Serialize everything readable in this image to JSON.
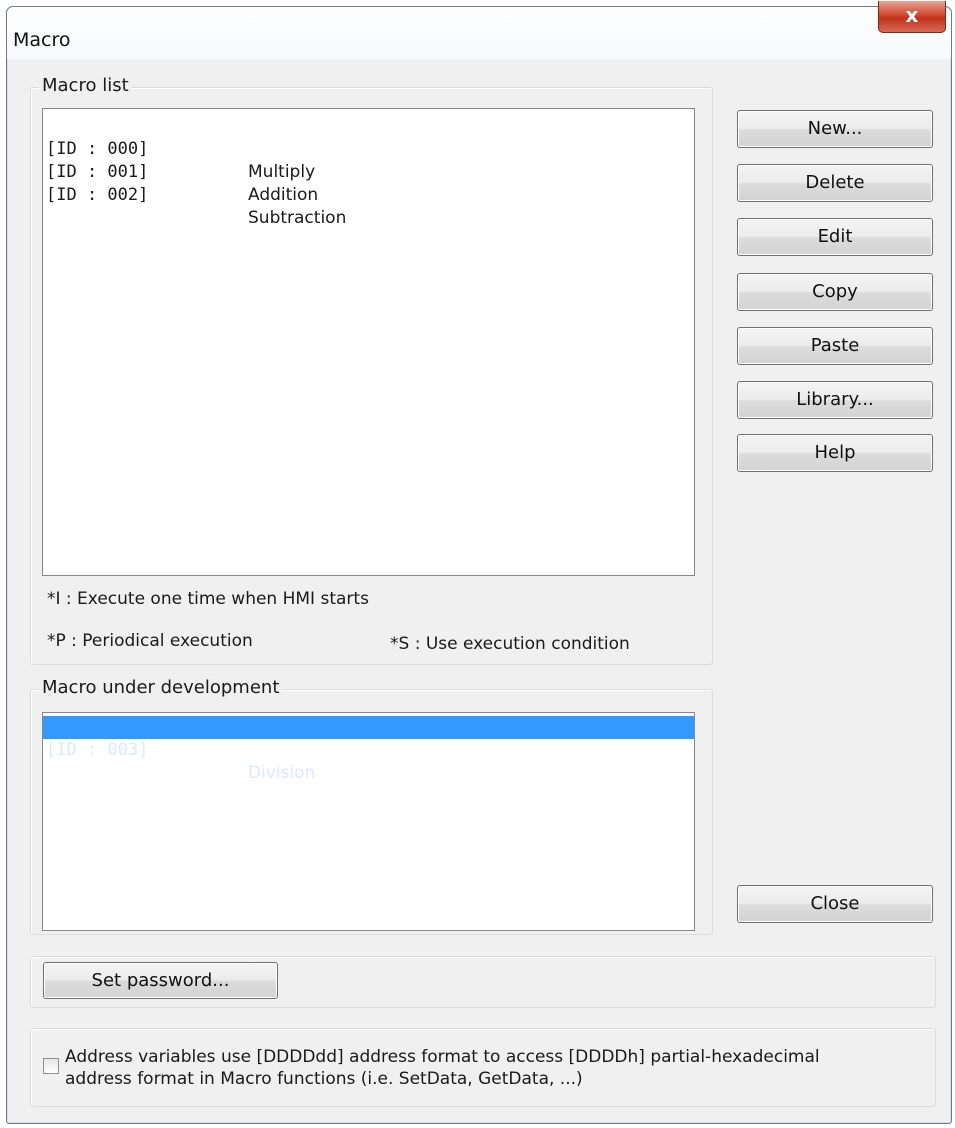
{
  "window": {
    "title": "Macro",
    "close_glyph": "x"
  },
  "macro_list": {
    "label": "Macro list",
    "items": [
      {
        "id": "[ID : 000]",
        "name": "Multiply"
      },
      {
        "id": "[ID : 001]",
        "name": "Addition"
      },
      {
        "id": "[ID : 002]",
        "name": "Subtraction"
      }
    ],
    "notes": {
      "i": "*I : Execute one time when HMI starts",
      "p": "*P : Periodical execution",
      "s": "*S : Use execution condition"
    }
  },
  "macro_dev": {
    "label": "Macro under development",
    "items": [
      {
        "id": "[ID : 003]",
        "name": "Division",
        "selected": true
      }
    ]
  },
  "buttons": {
    "new": "New...",
    "delete": "Delete",
    "edit": "Edit",
    "copy": "Copy",
    "paste": "Paste",
    "library": "Library...",
    "help": "Help",
    "close": "Close",
    "set_password": "Set password..."
  },
  "address_option": {
    "checked": false,
    "line1": "Address variables use [DDDDdd] address format to access [DDDDh] partial-hexadecimal",
    "line2": "address format in Macro functions (i.e. SetData, GetData, ...)"
  },
  "colors": {
    "selection": "#3399ff",
    "close_button": "#c7402a"
  }
}
